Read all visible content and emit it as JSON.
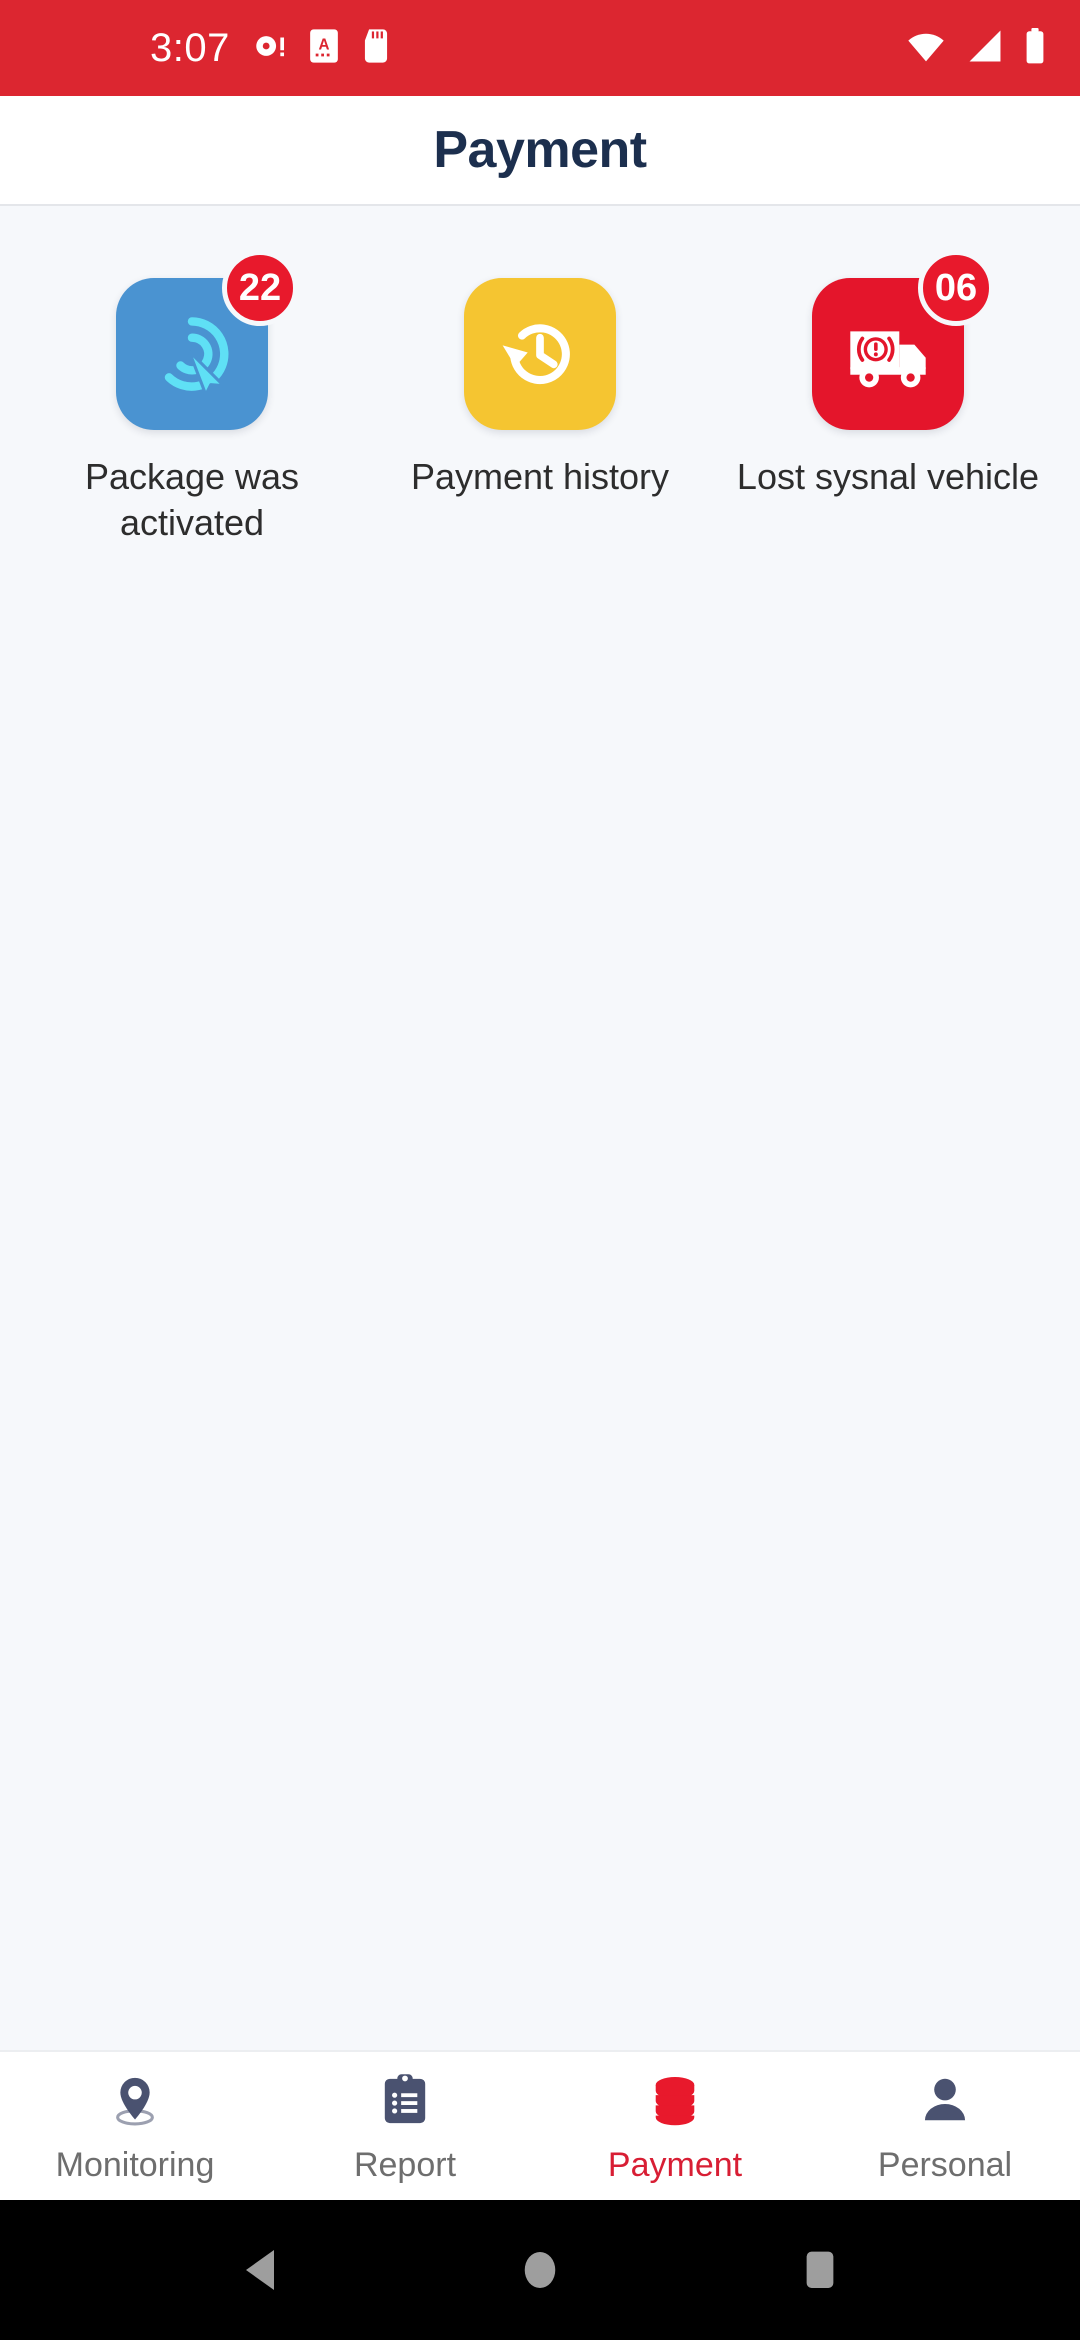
{
  "status_bar": {
    "time": "3:07",
    "left_icons": [
      "alarm-clock-icon",
      "screenshot-a-icon",
      "sd-card-icon"
    ],
    "right_icons": [
      "wifi-icon",
      "cellular-signal-icon",
      "battery-icon"
    ],
    "background_color": "#dc2630"
  },
  "app_bar": {
    "title": "Payment",
    "title_color": "#1c2f4e",
    "background_color": "#ffffff"
  },
  "content": {
    "background_color": "#f6f8fb",
    "tiles": [
      {
        "label": "Package was activated",
        "badge": "22",
        "icon": "tap-target-cursor-icon",
        "tile_color": "#4a93d1",
        "icon_color": "#5fe0f5",
        "badge_color": "#e8192c"
      },
      {
        "label": "Payment history",
        "badge": "",
        "icon": "history-clock-icon",
        "tile_color": "#f5c531",
        "icon_color": "#ffffff",
        "badge_color": ""
      },
      {
        "label": "Lost sysnal vehicle",
        "badge": "06",
        "icon": "truck-alert-icon",
        "tile_color": "#e4152b",
        "icon_color": "#ffffff",
        "badge_color": "#e8192c"
      }
    ]
  },
  "bottom_nav": {
    "active_color": "#d81e34",
    "inactive_color": "#6e6e6e",
    "items": [
      {
        "label": "Monitoring",
        "icon": "location-pin-icon",
        "active": false
      },
      {
        "label": "Report",
        "icon": "clipboard-list-icon",
        "active": false
      },
      {
        "label": "Payment",
        "icon": "coin-stack-icon",
        "active": true
      },
      {
        "label": "Personal",
        "icon": "person-icon",
        "active": false
      }
    ]
  },
  "android_nav": {
    "back_label": "Back",
    "home_label": "Home",
    "recents_label": "Recents",
    "background_color": "#000000"
  }
}
